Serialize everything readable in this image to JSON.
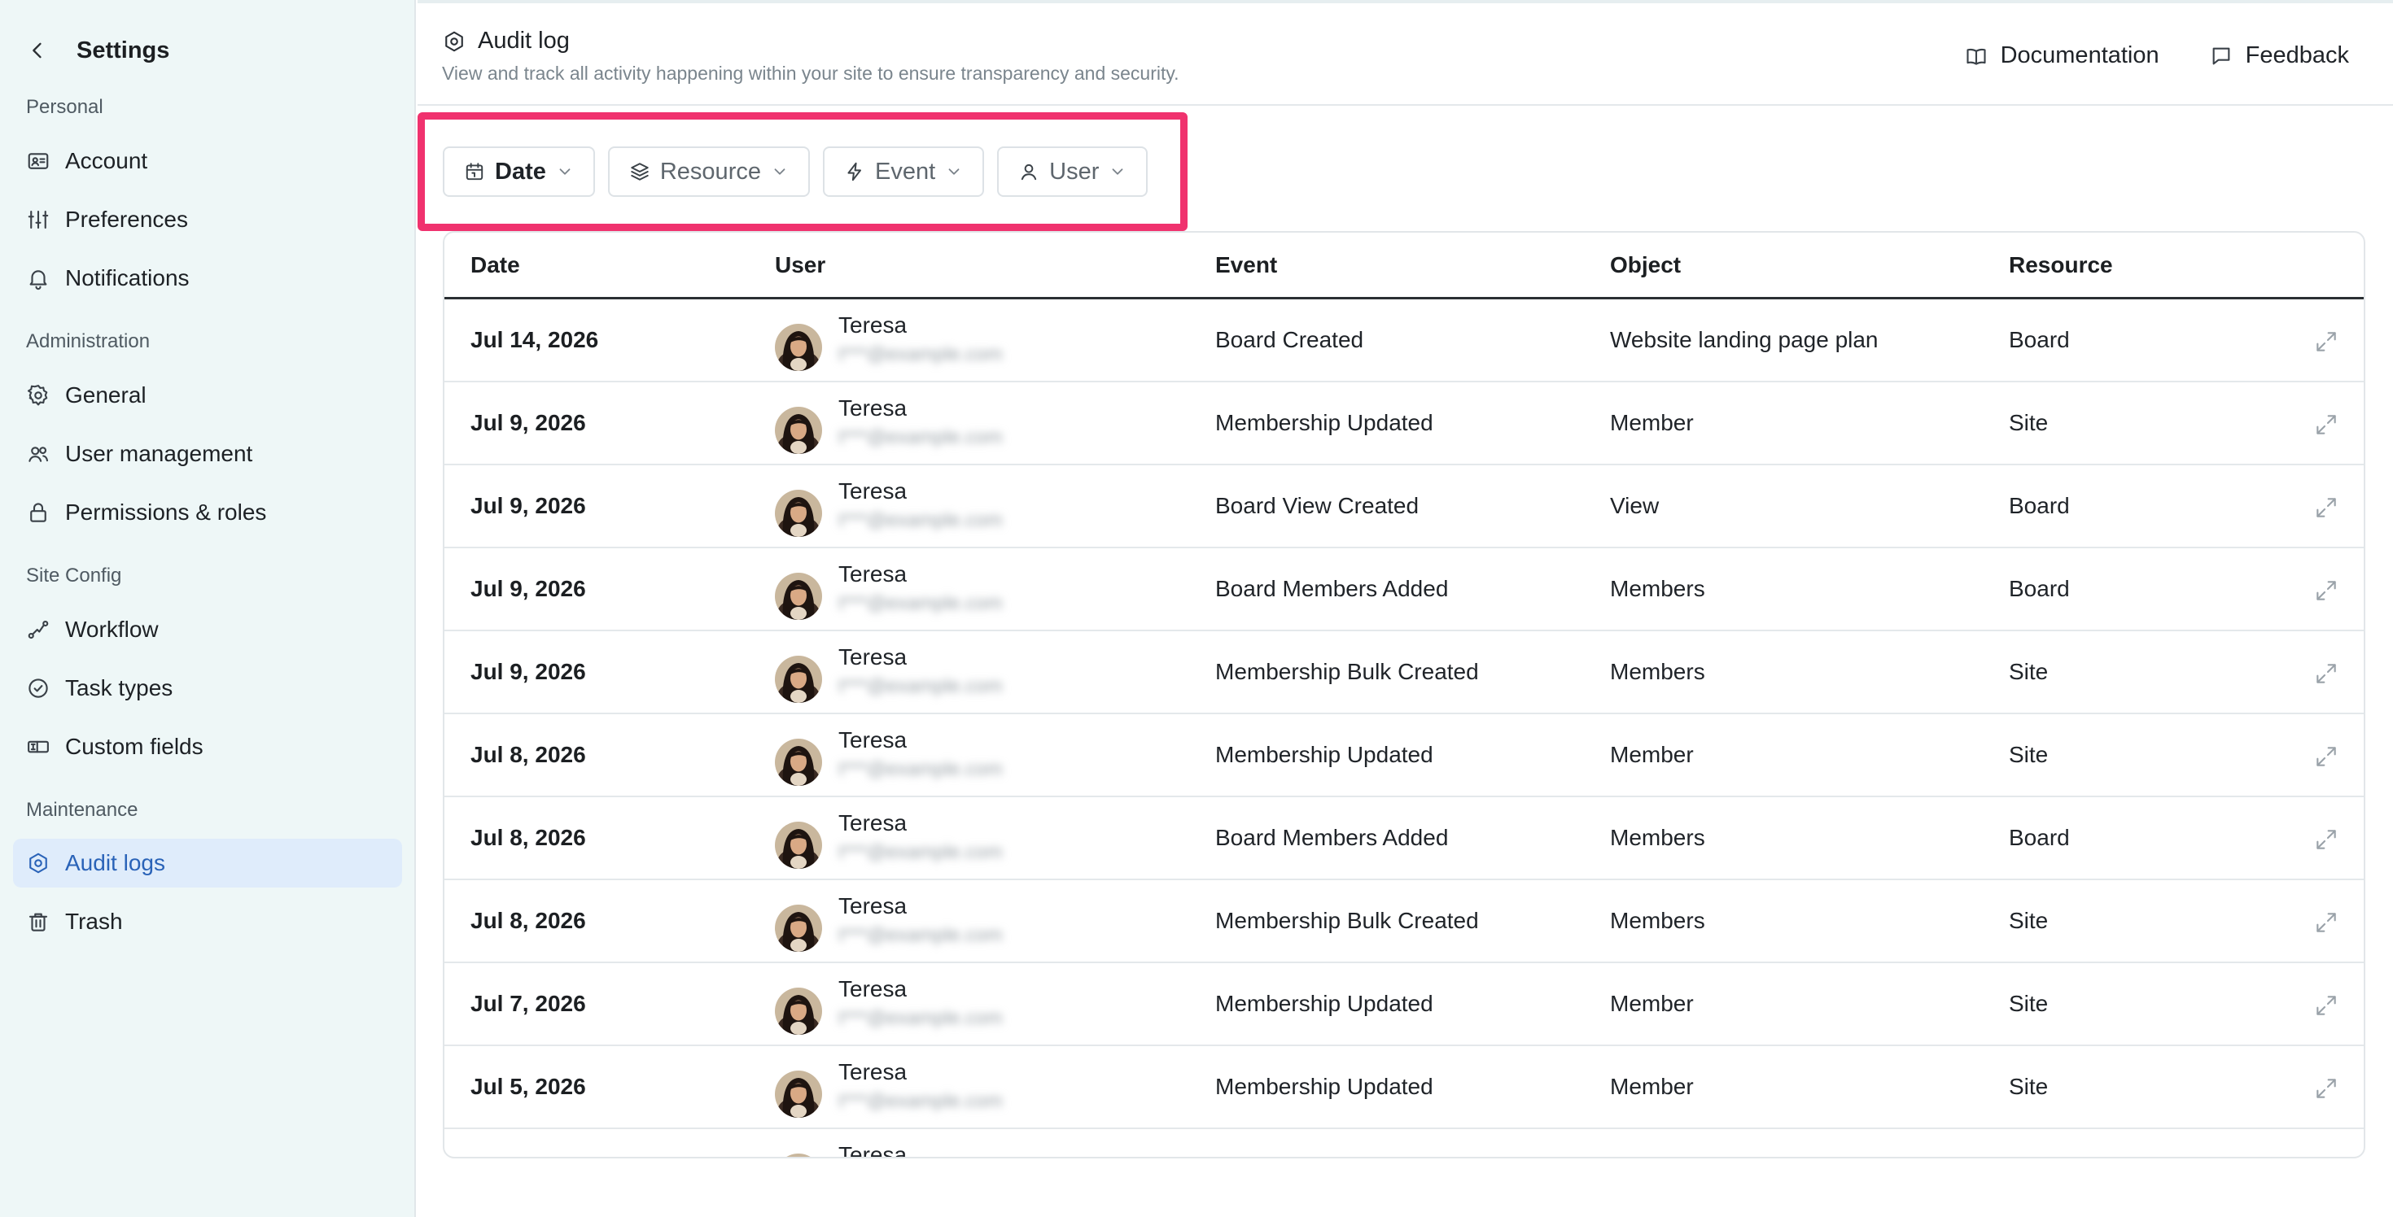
{
  "sidebar": {
    "title": "Settings",
    "sections": {
      "personal": "Personal",
      "administration": "Administration",
      "site_config": "Site Config",
      "maintenance": "Maintenance"
    },
    "items": {
      "account": "Account",
      "preferences": "Preferences",
      "notifications": "Notifications",
      "general": "General",
      "user_management": "User management",
      "permissions": "Permissions & roles",
      "workflow": "Workflow",
      "task_types": "Task types",
      "custom_fields": "Custom fields",
      "audit_logs": "Audit logs",
      "trash": "Trash"
    },
    "active_item": "audit_logs"
  },
  "header": {
    "title": "Audit log",
    "subtitle": "View and track all activity happening within your site to ensure transparency and security.",
    "documentation": "Documentation",
    "feedback": "Feedback"
  },
  "filters": {
    "date": "Date",
    "resource": "Resource",
    "event": "Event",
    "user": "User"
  },
  "table": {
    "columns": {
      "date": "Date",
      "user": "User",
      "event": "Event",
      "object": "Object",
      "resource": "Resource"
    },
    "rows": [
      {
        "date": "Jul 14, 2026",
        "user": "Teresa",
        "email": "t***@example.com",
        "event": "Board Created",
        "object": "Website landing page plan",
        "resource": "Board"
      },
      {
        "date": "Jul 9, 2026",
        "user": "Teresa",
        "email": "t***@example.com",
        "event": "Membership Updated",
        "object": "Member",
        "resource": "Site"
      },
      {
        "date": "Jul 9, 2026",
        "user": "Teresa",
        "email": "t***@example.com",
        "event": "Board View Created",
        "object": "View",
        "resource": "Board"
      },
      {
        "date": "Jul 9, 2026",
        "user": "Teresa",
        "email": "t***@example.com",
        "event": "Board Members Added",
        "object": "Members",
        "resource": "Board"
      },
      {
        "date": "Jul 9, 2026",
        "user": "Teresa",
        "email": "t***@example.com",
        "event": "Membership Bulk Created",
        "object": "Members",
        "resource": "Site"
      },
      {
        "date": "Jul 8, 2026",
        "user": "Teresa",
        "email": "t***@example.com",
        "event": "Membership Updated",
        "object": "Member",
        "resource": "Site"
      },
      {
        "date": "Jul 8, 2026",
        "user": "Teresa",
        "email": "t***@example.com",
        "event": "Board Members Added",
        "object": "Members",
        "resource": "Board"
      },
      {
        "date": "Jul 8, 2026",
        "user": "Teresa",
        "email": "t***@example.com",
        "event": "Membership Bulk Created",
        "object": "Members",
        "resource": "Site"
      },
      {
        "date": "Jul 7, 2026",
        "user": "Teresa",
        "email": "t***@example.com",
        "event": "Membership Updated",
        "object": "Member",
        "resource": "Site"
      },
      {
        "date": "Jul 5, 2026",
        "user": "Teresa",
        "email": "t***@example.com",
        "event": "Membership Updated",
        "object": "Member",
        "resource": "Site"
      },
      {
        "date": "",
        "user": "Teresa",
        "email": "",
        "event": "",
        "object": "",
        "resource": ""
      }
    ]
  },
  "colors": {
    "sidebar_bg": "#eef7f7",
    "active_item_bg": "#dfecfb",
    "accent": "#2a63b8",
    "highlight": "#f0326e"
  }
}
